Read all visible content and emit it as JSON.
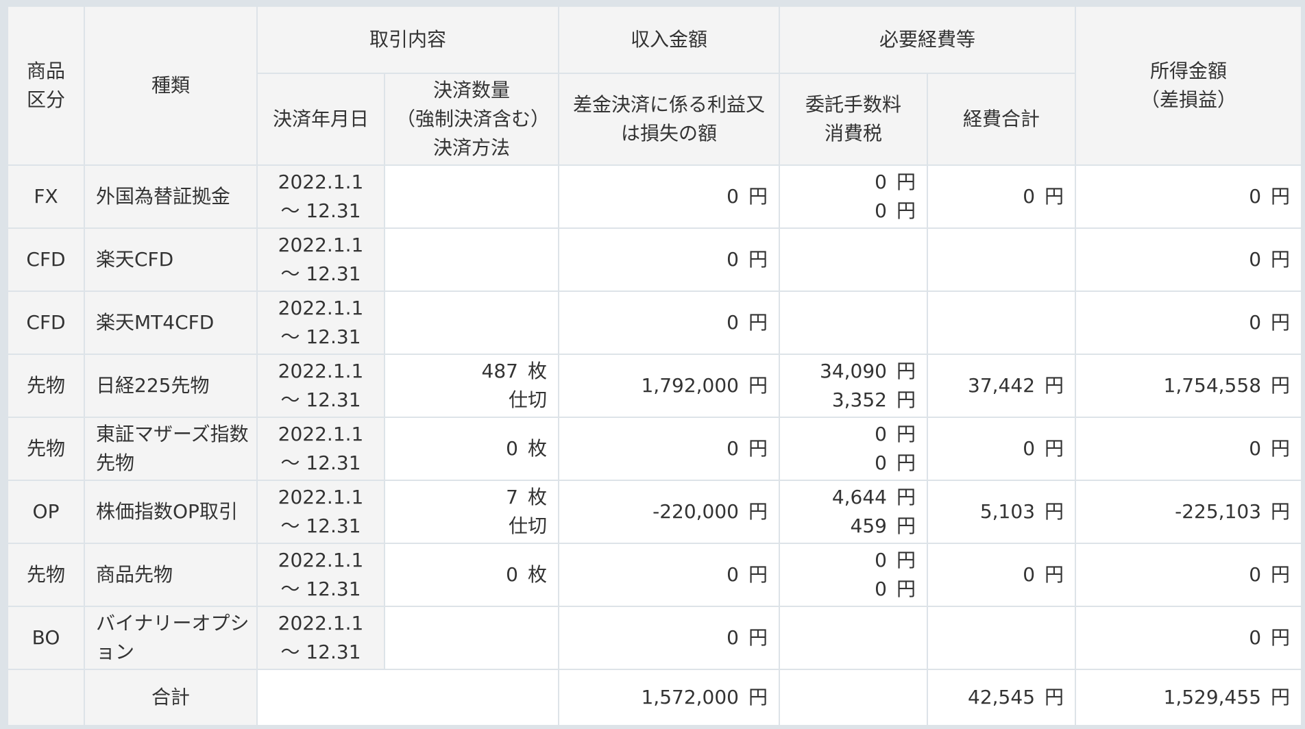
{
  "headers": {
    "category": "商品区分",
    "category_lines": [
      "商品",
      "区分"
    ],
    "kind": "種類",
    "transaction": "取引内容",
    "settle_date": "決済年月日",
    "settle_qty_lines": [
      "決済数量",
      "（強制決済含む）",
      "決済方法"
    ],
    "income": "収入金額",
    "income_sub_lines": [
      "差金決済に係る利益又",
      "は損失の額"
    ],
    "expenses": "必要経費等",
    "commission_lines": [
      "委託手数料",
      "消費税"
    ],
    "expense_total": "経費合計",
    "profit_lines": [
      "所得金額",
      "（差損益）"
    ]
  },
  "units": {
    "yen": "円"
  },
  "rows": [
    {
      "category": "FX",
      "kind": "外国為替証拠金",
      "date1": "2022.1.1",
      "date2": "～ 12.31",
      "qty": "",
      "qty_unit": "",
      "method": "",
      "income": "0",
      "commission": "0",
      "tax": "0",
      "expense_total": "0",
      "profit": "0"
    },
    {
      "category": "CFD",
      "kind": "楽天CFD",
      "date1": "2022.1.1",
      "date2": "～ 12.31",
      "qty": "",
      "qty_unit": "",
      "method": "",
      "income": "0",
      "commission": "",
      "tax": "",
      "expense_total": "",
      "profit": "0"
    },
    {
      "category": "CFD",
      "kind": "楽天MT4CFD",
      "date1": "2022.1.1",
      "date2": "～ 12.31",
      "qty": "",
      "qty_unit": "",
      "method": "",
      "income": "0",
      "commission": "",
      "tax": "",
      "expense_total": "",
      "profit": "0"
    },
    {
      "category": "先物",
      "kind": "日経225先物",
      "date1": "2022.1.1",
      "date2": "～ 12.31",
      "qty": "487",
      "qty_unit": "枚",
      "method": "仕切",
      "income": "1,792,000",
      "commission": "34,090",
      "tax": "3,352",
      "expense_total": "37,442",
      "profit": "1,754,558"
    },
    {
      "category": "先物",
      "kind": "東証マザーズ指数先物",
      "kind_lines": [
        "東証マザーズ指数",
        "先物"
      ],
      "date1": "2022.1.1",
      "date2": "～ 12.31",
      "qty": "0",
      "qty_unit": "枚",
      "method": "",
      "income": "0",
      "commission": "0",
      "tax": "0",
      "expense_total": "0",
      "profit": "0"
    },
    {
      "category": "OP",
      "kind": "株価指数OP取引",
      "date1": "2022.1.1",
      "date2": "～ 12.31",
      "qty": "7",
      "qty_unit": "枚",
      "method": "仕切",
      "income": "-220,000",
      "commission": "4,644",
      "tax": "459",
      "expense_total": "5,103",
      "profit": "-225,103"
    },
    {
      "category": "先物",
      "kind": "商品先物",
      "date1": "2022.1.1",
      "date2": "～ 12.31",
      "qty": "0",
      "qty_unit": "枚",
      "method": "",
      "income": "0",
      "commission": "0",
      "tax": "0",
      "expense_total": "0",
      "profit": "0"
    },
    {
      "category": "BO",
      "kind": "バイナリーオプション",
      "kind_lines": [
        "バイナリーオプシ",
        "ョン"
      ],
      "date1": "2022.1.1",
      "date2": "～ 12.31",
      "qty": "",
      "qty_unit": "",
      "method": "",
      "income": "0",
      "commission": "",
      "tax": "",
      "expense_total": "",
      "profit": "0"
    }
  ],
  "total": {
    "label": "合計",
    "income": "1,572,000",
    "expense_total": "42,545",
    "profit": "1,529,455"
  },
  "colors": {
    "border": "#dde3e8",
    "header_bg": "#f4f4f4",
    "cell_bg": "#ffffff",
    "text": "#333333"
  }
}
